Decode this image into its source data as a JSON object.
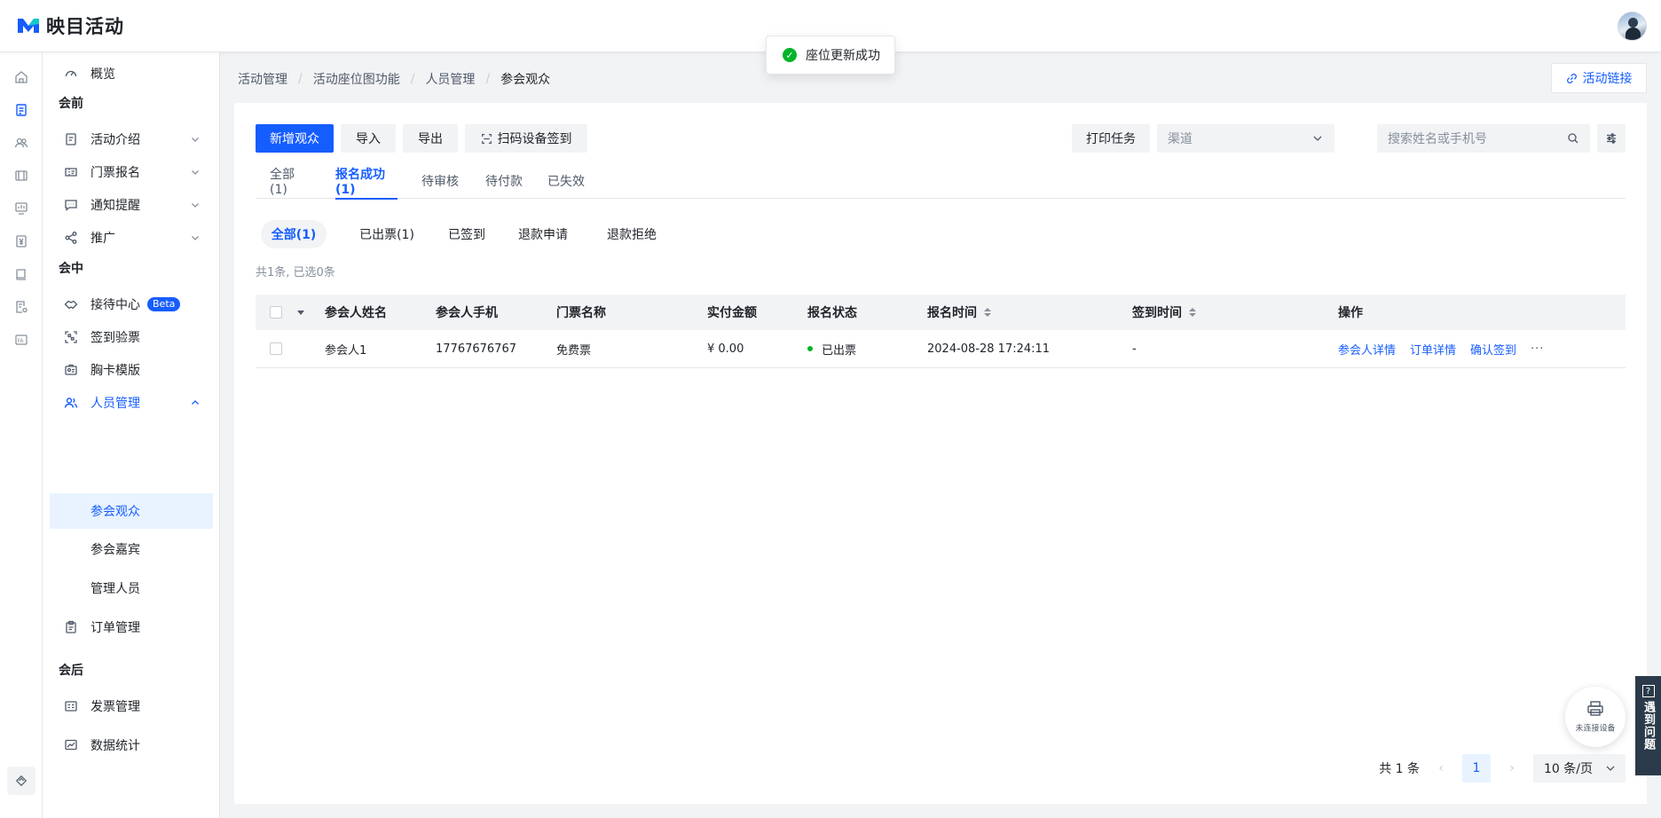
{
  "app": {
    "name": "映目活动"
  },
  "toast": {
    "message": "座位更新成功"
  },
  "breadcrumb": [
    "活动管理",
    "活动座位图功能",
    "人员管理",
    "参会观众"
  ],
  "header_actions": {
    "activity_link": "活动链接"
  },
  "sidebar": {
    "overview": "概览",
    "groups": {
      "before": "会前",
      "during": "会中",
      "after": "会后"
    },
    "items": {
      "intro": "活动介绍",
      "ticket": "门票报名",
      "notify": "通知提醒",
      "promote": "推广",
      "reception": "接待中心",
      "reception_badge": "Beta",
      "checkin": "签到验票",
      "badge": "胸卡模版",
      "people": "人员管理",
      "order": "订单管理",
      "invoice": "发票管理",
      "stats": "数据统计"
    },
    "sub": {
      "audience": "参会观众",
      "guest": "参会嘉宾",
      "admin": "管理人员"
    }
  },
  "toolbar": {
    "add": "新增观众",
    "import": "导入",
    "export": "导出",
    "scan": "扫码设备签到",
    "print": "打印任务",
    "channel_placeholder": "渠道",
    "search_placeholder": "搜索姓名或手机号"
  },
  "tabs": [
    "全部(1)",
    "报名成功(1)",
    "待审核",
    "待付款",
    "已失效"
  ],
  "subtabs": [
    "全部(1)",
    "已出票(1)",
    "已签到",
    "退款申请",
    "退款拒绝"
  ],
  "selection_summary": "共1条, 已选0条",
  "table": {
    "headers": [
      "参会人姓名",
      "参会人手机",
      "门票名称",
      "实付金额",
      "报名状态",
      "报名时间",
      "签到时间",
      "操作"
    ],
    "rows": [
      {
        "name": "参会人1",
        "phone": "17767676767",
        "ticket": "免费票",
        "amount": "¥ 0.00",
        "status": "已出票",
        "reg_time": "2024-08-28 17:24:11",
        "checkin_time": "-",
        "actions": [
          "参会人详情",
          "订单详情",
          "确认签到"
        ]
      }
    ]
  },
  "pagination": {
    "total": "共 1 条",
    "current": "1",
    "page_size": "10 条/页"
  },
  "floating": {
    "printer": "未连接设备",
    "help": "遇到问题"
  },
  "colors": {
    "primary": "#165dff",
    "success": "#00b42a"
  }
}
